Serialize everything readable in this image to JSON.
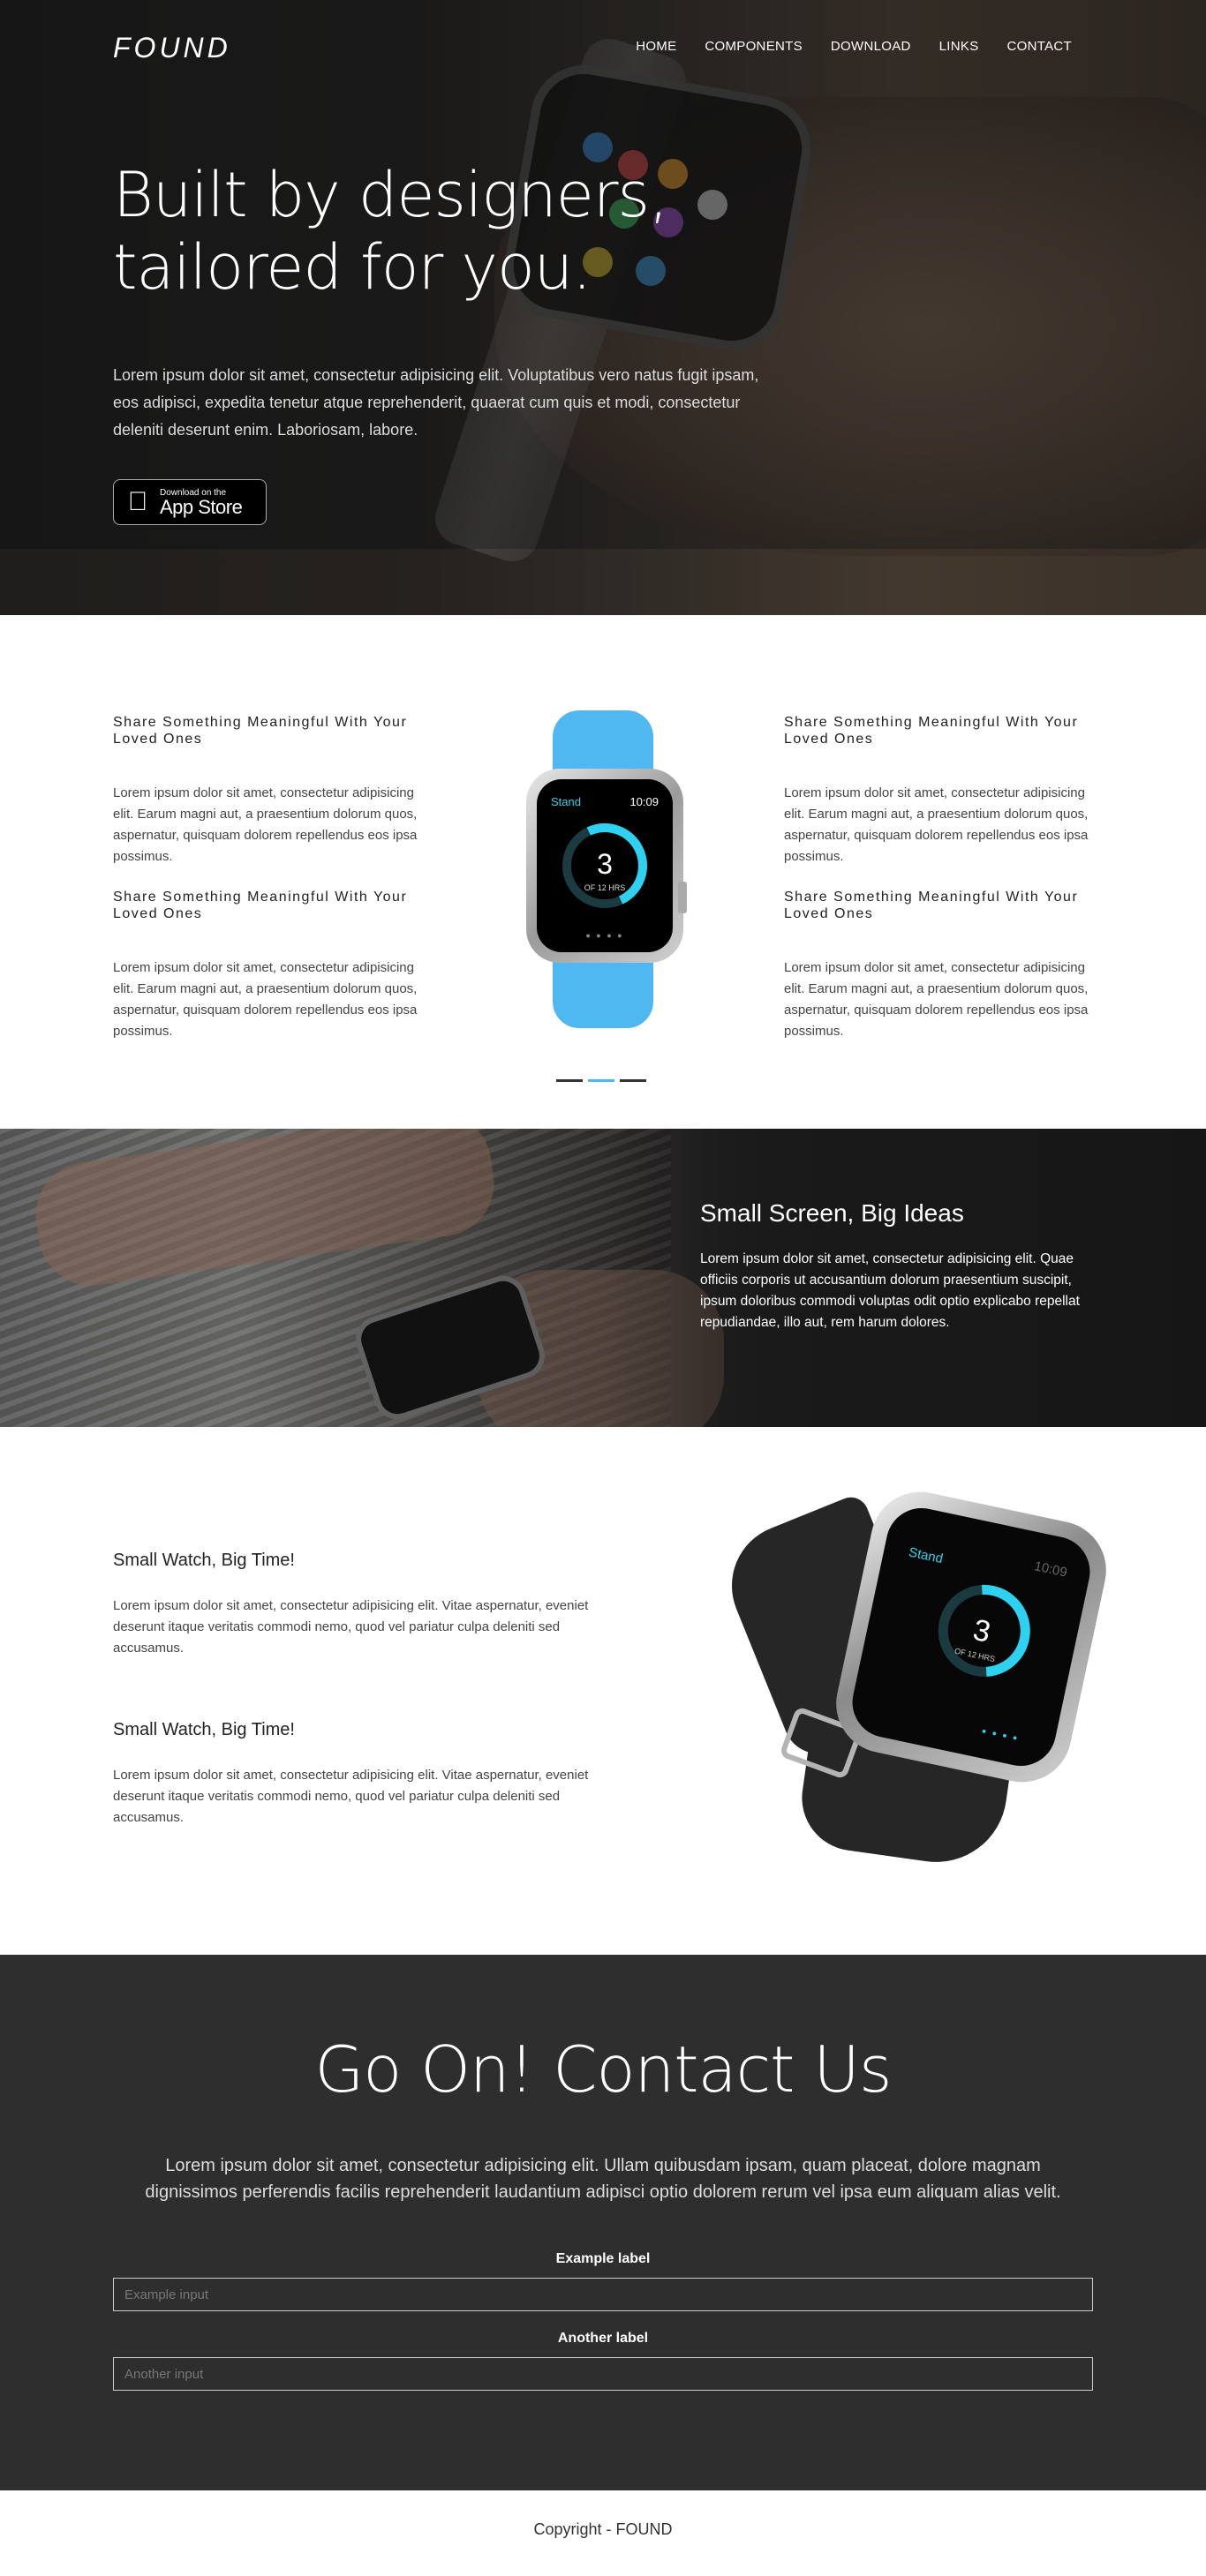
{
  "brand": "FOUND",
  "nav": [
    "HOME",
    "COMPONENTS",
    "DOWNLOAD",
    "LINKS",
    "CONTACT"
  ],
  "hero": {
    "title_line1": "Built by designers,",
    "title_line2": "tailored for you.",
    "text": "Lorem ipsum dolor sit amet, consectetur adipisicing elit. Voluptatibus vero natus fugit ipsam, eos adipisci, expedita tenetur atque reprehenderit, quaerat cum quis et modi, consectetur deleniti deserunt enim. Laboriosam, labore.",
    "appstore_small": "Download on the",
    "appstore_big": "App Store"
  },
  "features": {
    "items": [
      {
        "title": "Share Something Meaningful With Your Loved Ones",
        "text": "Lorem ipsum dolor sit amet, consectetur adipisicing elit. Earum magni aut, a praesentium dolorum quos, aspernatur, quisquam dolorem repellendus eos ipsa possimus."
      },
      {
        "title": "Share Something Meaningful With Your Loved Ones",
        "text": "Lorem ipsum dolor sit amet, consectetur adipisicing elit. Earum magni aut, a praesentium dolorum quos, aspernatur, quisquam dolorem repellendus eos ipsa possimus."
      },
      {
        "title": "Share Something Meaningful With Your Loved Ones",
        "text": "Lorem ipsum dolor sit amet, consectetur adipisicing elit. Earum magni aut, a praesentium dolorum quos, aspernatur, quisquam dolorem repellendus eos ipsa possimus."
      },
      {
        "title": "Share Something Meaningful With Your Loved Ones",
        "text": "Lorem ipsum dolor sit amet, consectetur adipisicing elit. Earum magni aut, a praesentium dolorum quos, aspernatur, quisquam dolorem repellendus eos ipsa possimus."
      }
    ],
    "watch": {
      "stand": "Stand",
      "time": "10:09",
      "value": "3",
      "sub": "OF 12 HRS",
      "dots": "● ● ● ●"
    }
  },
  "banner": {
    "title": "Small Screen, Big Ideas",
    "text": "Lorem ipsum dolor sit amet, consectetur adipisicing elit. Quae officiis corporis ut accusantium dolorum praesentium suscipit, ipsum doloribus commodi voluptas odit optio explicabo repellat repudiandae, illo aut, rem harum dolores."
  },
  "smallwatch": {
    "items": [
      {
        "title": "Small Watch, Big Time!",
        "text": "Lorem ipsum dolor sit amet, consectetur adipisicing elit. Vitae aspernatur, eveniet deserunt itaque veritatis commodi nemo, quod vel pariatur culpa deleniti sed accusamus."
      },
      {
        "title": "Small Watch, Big Time!",
        "text": "Lorem ipsum dolor sit amet, consectetur adipisicing elit. Vitae aspernatur, eveniet deserunt itaque veritatis commodi nemo, quod vel pariatur culpa deleniti sed accusamus."
      }
    ],
    "watch": {
      "stand": "Stand",
      "time": "10:09",
      "value": "3",
      "sub": "OF 12 HRS",
      "dots": "● ● ● ●"
    }
  },
  "contact": {
    "title": "Go On! Contact Us",
    "lead": "Lorem ipsum dolor sit amet, consectetur adipisicing elit. Ullam quibusdam ipsam, quam placeat, dolore magnam dignissimos perferendis facilis reprehenderit laudantium adipisci optio dolorem rerum vel ipsa eum aliquam alias velit.",
    "label1": "Example label",
    "placeholder1": "Example input",
    "label2": "Another label",
    "placeholder2": "Another input"
  },
  "footer": "Copyright - FOUND",
  "colors": {
    "accent": "#4fb8f0",
    "dark": "#2e2e2e",
    "ring": "#2ed2f0"
  },
  "icons": {
    "appstore": "apple-icon"
  }
}
